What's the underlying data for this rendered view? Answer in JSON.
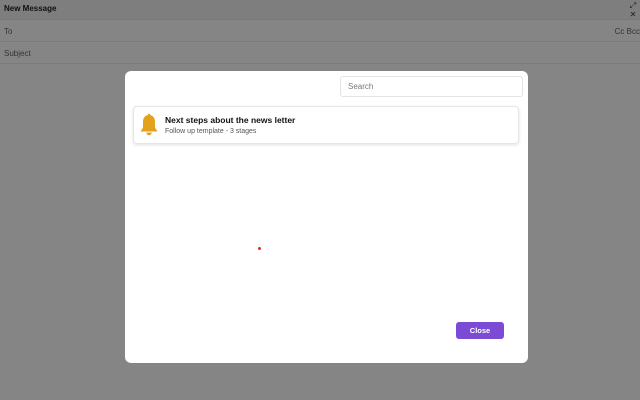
{
  "compose": {
    "title": "New Message",
    "expand_icon": "expand-icon",
    "close_icon": "close-icon",
    "to_label": "To",
    "cc_bcc_label": "Cc Bcc",
    "subject_label": "Subject"
  },
  "modal": {
    "search_placeholder": "Search",
    "templates": [
      {
        "icon": "bell-icon",
        "icon_color": "#e3a11c",
        "title": "Next steps about the news letter",
        "subtitle": "Follow up template - 3 stages"
      }
    ],
    "close_label": "Close",
    "accent_color": "#7b4bd6"
  }
}
